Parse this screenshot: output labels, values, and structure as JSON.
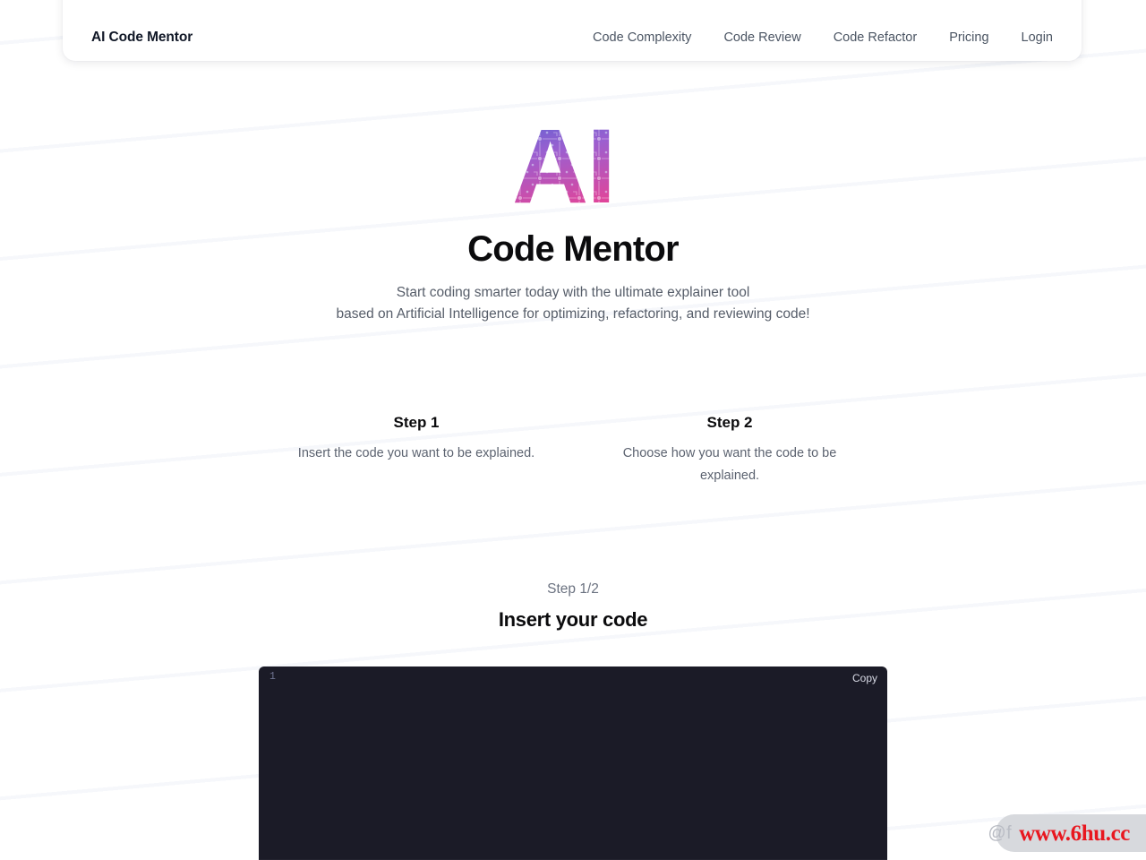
{
  "header": {
    "brand": "AI Code Mentor",
    "nav": [
      {
        "label": "Code Complexity"
      },
      {
        "label": "Code Review"
      },
      {
        "label": "Code Refactor"
      },
      {
        "label": "Pricing"
      },
      {
        "label": "Login"
      }
    ]
  },
  "hero": {
    "logo_text": "AI",
    "logo_gradient_start": "#4f63d2",
    "logo_gradient_mid": "#9b5fd0",
    "logo_gradient_end": "#e0459a",
    "title": "Code Mentor",
    "subtitle_line1": "Start coding smarter today with the ultimate explainer tool",
    "subtitle_line2": "based on Artificial Intelligence for optimizing, refactoring, and reviewing code!"
  },
  "steps": [
    {
      "title": "Step 1",
      "description": "Insert the code you want to be explained."
    },
    {
      "title": "Step 2",
      "description": "Choose how you want the code to be explained."
    }
  ],
  "editor_section": {
    "step_counter": "Step 1/2",
    "heading": "Insert your code",
    "line_number": "1",
    "copy_label": "Copy",
    "code_value": "",
    "code_placeholder": "",
    "editor_bg": "#1b1b27"
  },
  "watermark": {
    "handle": "@f",
    "url": "www.6hu.cc",
    "url_color": "#e8171f",
    "pill_color": "#d7d9dd"
  }
}
